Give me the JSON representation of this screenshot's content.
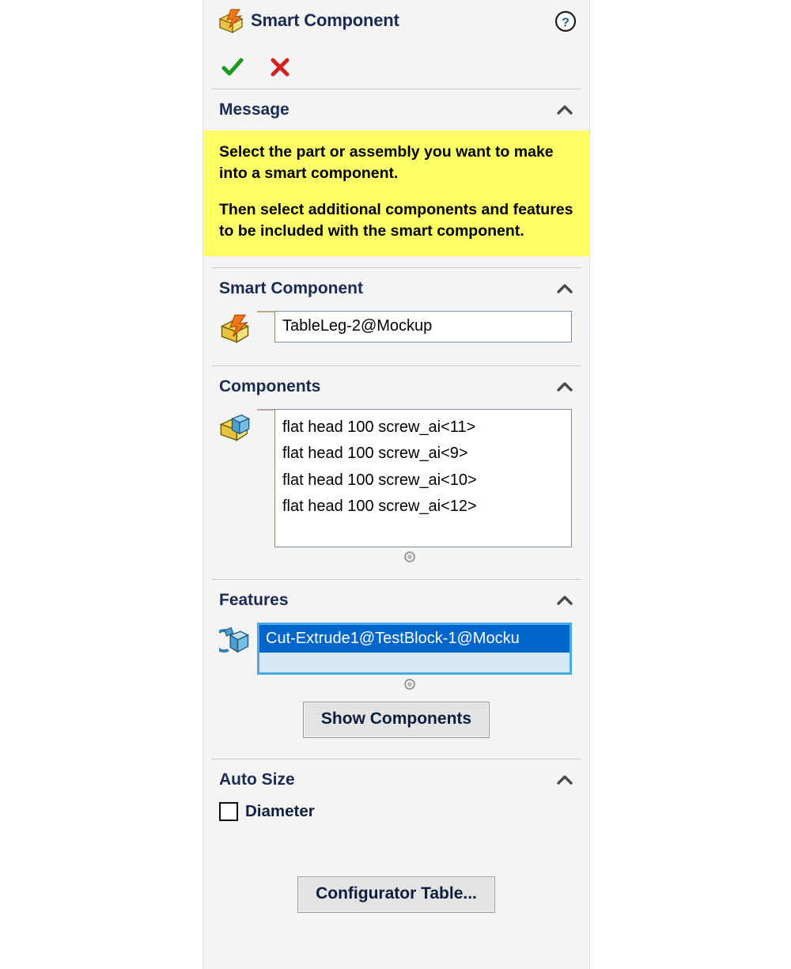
{
  "panel": {
    "title": "Smart Component",
    "title_icon": "smart-component-icon",
    "help_icon": "help-icon",
    "accept_icon": "checkmark-icon",
    "cancel_icon": "cancel-x-icon",
    "accept_label": "OK",
    "cancel_label": "Cancel"
  },
  "colors": {
    "panel_bg": "#f4f4f4",
    "title_text": "#1b2a55",
    "message_bg": "#ffff66",
    "accept_green": "#1a9a1a",
    "cancel_red": "#d42020",
    "selection_blue": "#3399ee",
    "components_pink": "#ff77bb",
    "highlight_blue": "#0066cc",
    "focus_border": "#4aaae5"
  },
  "sections": {
    "message": {
      "title": "Message",
      "collapse_icon": "chevron-up-icon",
      "paragraphs": [
        "Select the part or assembly you want to make into a smart component.",
        "Then select additional components and features to be included with the smart component."
      ]
    },
    "smart_component": {
      "title": "Smart Component",
      "collapse_icon": "chevron-up-icon",
      "row_icon": "smart-component-icon",
      "swatch_color": "#3399ee",
      "value": "TableLeg-2@Mockup",
      "placeholder": ""
    },
    "components": {
      "title": "Components",
      "collapse_icon": "chevron-up-icon",
      "row_icon": "component-box-icon",
      "swatch_color": "#ff77bb",
      "items": [
        "flat head 100 screw_ai<11>",
        "flat head 100 screw_ai<9>",
        "flat head 100 screw_ai<10>",
        "flat head 100 screw_ai<12>"
      ],
      "resize_grip_icon": "resize-grip-icon"
    },
    "features": {
      "title": "Features",
      "collapse_icon": "chevron-up-icon",
      "row_icon": "feature-cube-icon",
      "items": [
        "Cut-Extrude1@TestBlock-1@Mocku"
      ],
      "resize_grip_icon": "resize-grip-icon",
      "show_components_button": "Show Components"
    },
    "auto_size": {
      "title": "Auto Size",
      "collapse_icon": "chevron-up-icon",
      "diameter_label": "Diameter",
      "diameter_checked": false,
      "configurator_button": "Configurator Table..."
    }
  }
}
